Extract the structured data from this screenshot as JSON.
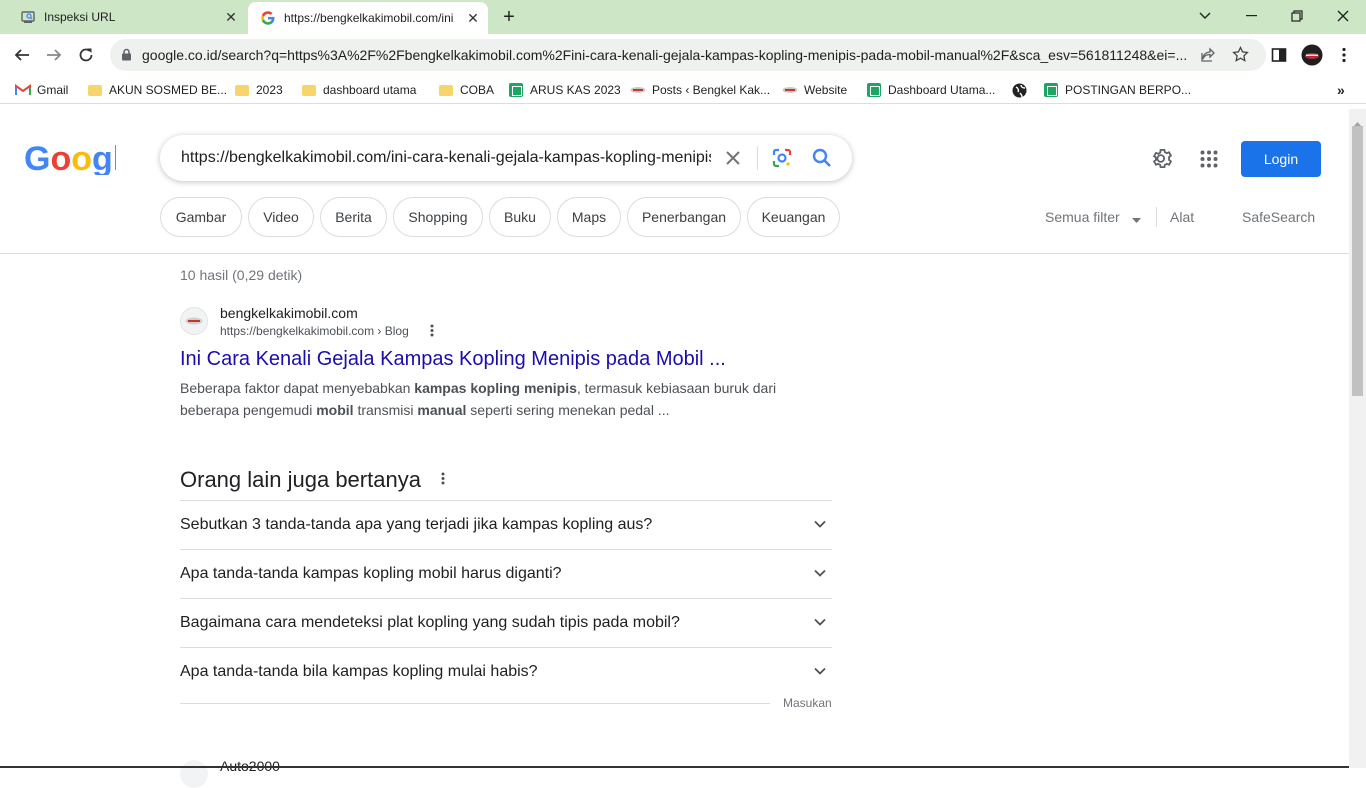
{
  "browser": {
    "tabs": [
      {
        "title": "Inspeksi URL",
        "icon": "search-console-icon"
      },
      {
        "title": "https://bengkelkakimobil.com/ini",
        "icon": "google-g-icon"
      }
    ],
    "new_tab_label": "+",
    "address": "google.co.id/search?q=https%3A%2F%2Fbengkelkakimobil.com%2Fini-cara-kenali-gejala-kampas-kopling-menipis-pada-mobil-manual%2F&sca_esv=561811248&ei=...",
    "bookmarks": [
      {
        "label": "Gmail",
        "icon": "gmail-icon"
      },
      {
        "label": "AKUN SOSMED BE...",
        "icon": "folder-icon"
      },
      {
        "label": "2023",
        "icon": "folder-icon"
      },
      {
        "label": "dashboard utama",
        "icon": "folder-icon"
      },
      {
        "label": "COBA",
        "icon": "folder-icon"
      },
      {
        "label": "ARUS KAS 2023",
        "icon": "sheets-icon"
      },
      {
        "label": "Posts ‹ Bengkel Kak...",
        "icon": "site-icon"
      },
      {
        "label": "Website",
        "icon": "site-icon"
      },
      {
        "label": "Dashboard Utama...",
        "icon": "sheets-icon"
      },
      {
        "label": "",
        "icon": "globe-icon"
      },
      {
        "label": "POSTINGAN BERPO...",
        "icon": "sheets-icon"
      }
    ]
  },
  "google": {
    "logo": "Google",
    "query": "https://bengkelkakimobil.com/ini-cara-kenali-gejala-kampas-kopling-menipis-pada-mobil-manual/",
    "login_label": "Login",
    "chips": [
      "Gambar",
      "Video",
      "Berita",
      "Shopping",
      "Buku",
      "Maps",
      "Penerbangan",
      "Keuangan"
    ],
    "tools": {
      "all_filters": "Semua filter",
      "tools": "Alat",
      "safesearch": "SafeSearch"
    }
  },
  "results": {
    "stats": "10 hasil (0,29 detik)",
    "first": {
      "site_name": "bengkelkakimobil.com",
      "url": "https://bengkelkakimobil.com › Blog",
      "title": "Ini Cara Kenali Gejala Kampas Kopling Menipis pada Mobil ...",
      "snippet_parts": [
        {
          "text": "Beberapa faktor dapat menyebabkan ",
          "bold": false
        },
        {
          "text": "kampas kopling menipis",
          "bold": true
        },
        {
          "text": ", termasuk kebiasaan buruk dari beberapa pengemudi ",
          "bold": false
        },
        {
          "text": "mobil",
          "bold": true
        },
        {
          "text": " transmisi ",
          "bold": false
        },
        {
          "text": "manual",
          "bold": true
        },
        {
          "text": " seperti sering menekan pedal ...",
          "bold": false
        }
      ]
    },
    "paa": {
      "title": "Orang lain juga bertanya",
      "questions": [
        "Sebutkan 3 tanda-tanda apa yang terjadi jika kampas kopling aus?",
        "Apa tanda-tanda kampas kopling mobil harus diganti?",
        "Bagaimana cara mendeteksi plat kopling yang sudah tipis pada mobil?",
        "Apa tanda-tanda bila kampas kopling mulai habis?"
      ],
      "feedback": "Masukan"
    },
    "next_site": "Auto2000"
  }
}
